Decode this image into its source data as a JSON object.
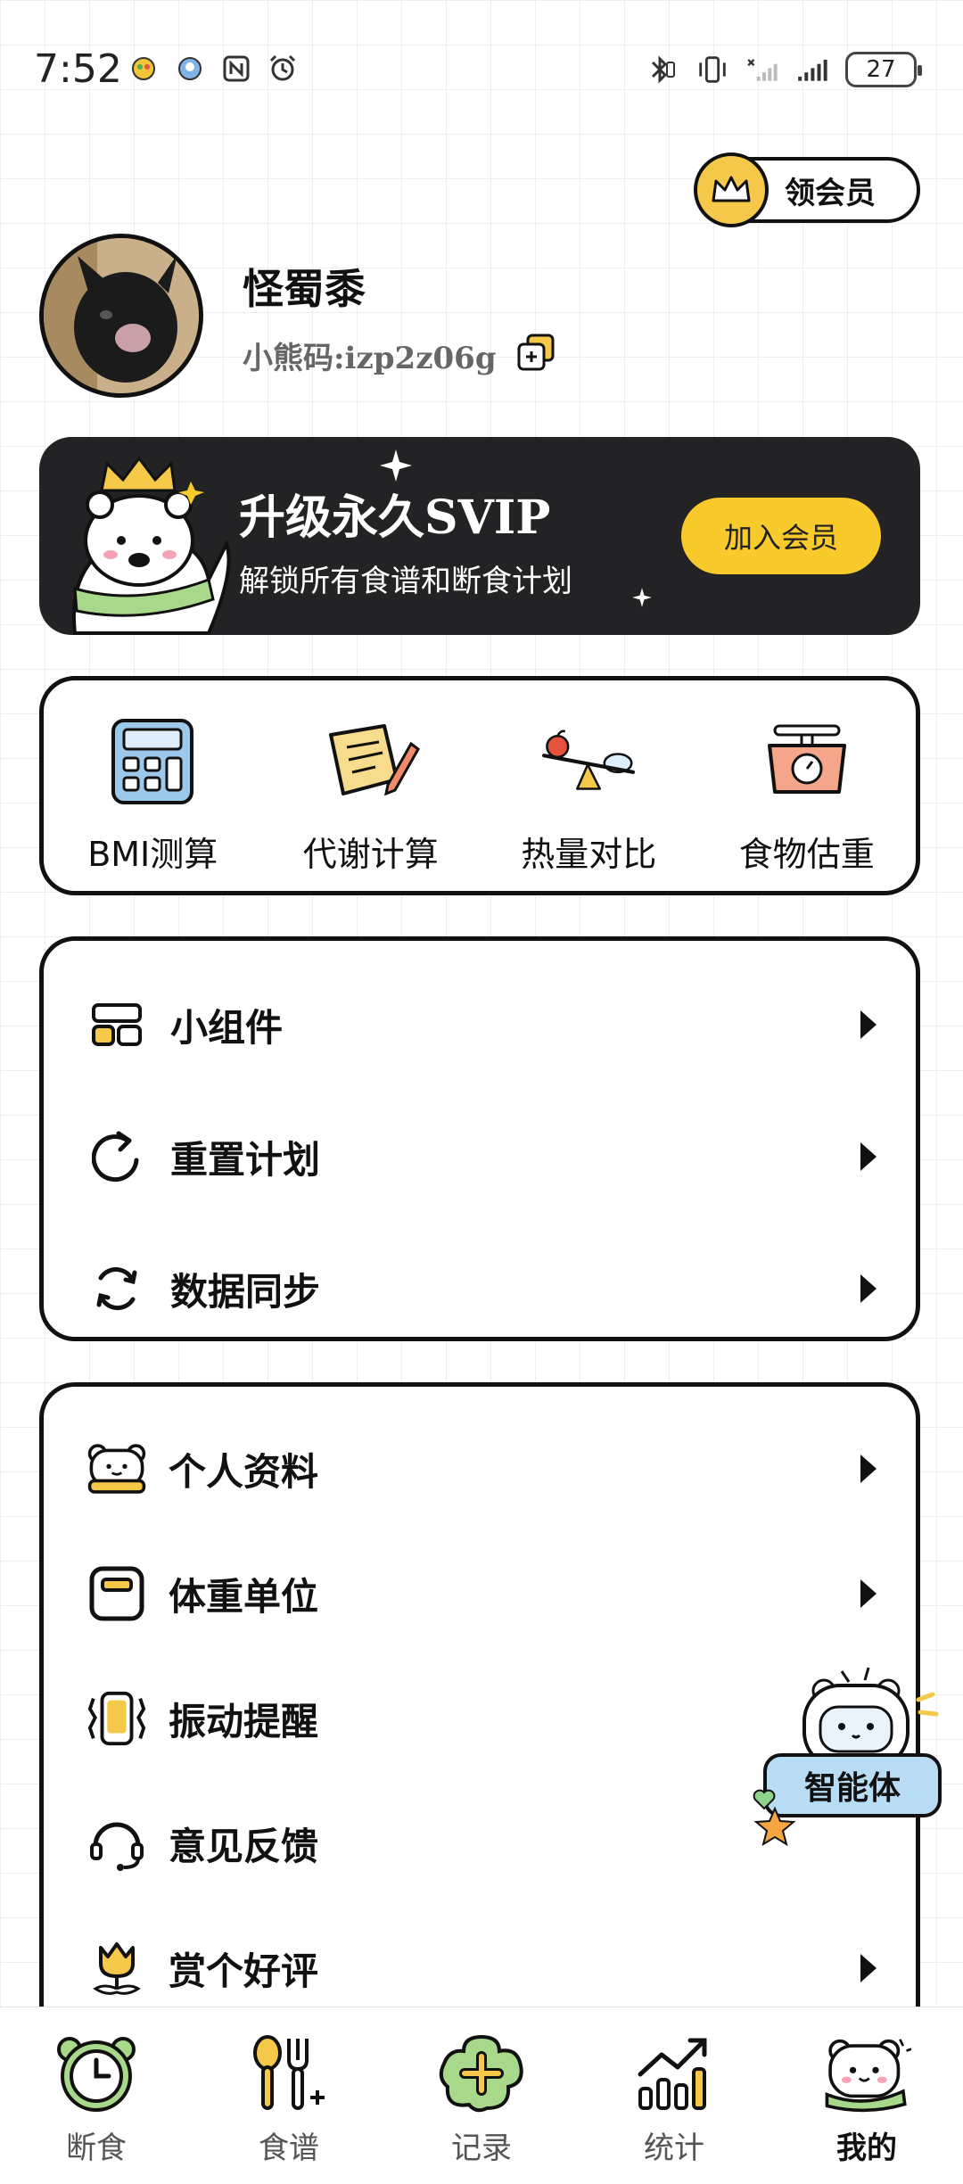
{
  "status_bar": {
    "time": "7:52",
    "battery": "27"
  },
  "vip_pill": {
    "label": "领会员"
  },
  "profile": {
    "name": "怪蜀黍",
    "code": "小熊码:izp2z06g"
  },
  "svip_banner": {
    "title": "升级永久SVIP",
    "subtitle": "解锁所有食谱和断食计划",
    "button": "加入会员"
  },
  "tools": [
    {
      "label": "BMI测算",
      "icon": "calculator-icon"
    },
    {
      "label": "代谢计算",
      "icon": "scroll-pen-icon"
    },
    {
      "label": "热量对比",
      "icon": "seesaw-icon"
    },
    {
      "label": "食物估重",
      "icon": "scale-icon"
    }
  ],
  "menu_group_1": [
    {
      "label": "小组件",
      "icon": "widget-icon"
    },
    {
      "label": "重置计划",
      "icon": "reset-icon"
    },
    {
      "label": "数据同步",
      "icon": "sync-icon"
    }
  ],
  "menu_group_2": [
    {
      "label": "个人资料",
      "icon": "bear-profile-icon"
    },
    {
      "label": "体重单位",
      "icon": "weight-unit-icon"
    },
    {
      "label": "振动提醒",
      "icon": "vibrate-icon"
    },
    {
      "label": "意见反馈",
      "icon": "headset-icon"
    },
    {
      "label": "赏个好评",
      "icon": "tulip-icon"
    }
  ],
  "agent": {
    "label": "智能体"
  },
  "bottom_nav": [
    {
      "label": "断食",
      "icon": "clock-icon"
    },
    {
      "label": "食谱",
      "icon": "utensils-icon"
    },
    {
      "label": "记录",
      "icon": "plus-icon"
    },
    {
      "label": "统计",
      "icon": "chart-icon"
    },
    {
      "label": "我的",
      "icon": "bear-face-icon",
      "active": true
    }
  ],
  "colors": {
    "accent_yellow": "#f8ca2b",
    "banner_dark": "#232325",
    "agent_blue": "#b9dcf5"
  }
}
